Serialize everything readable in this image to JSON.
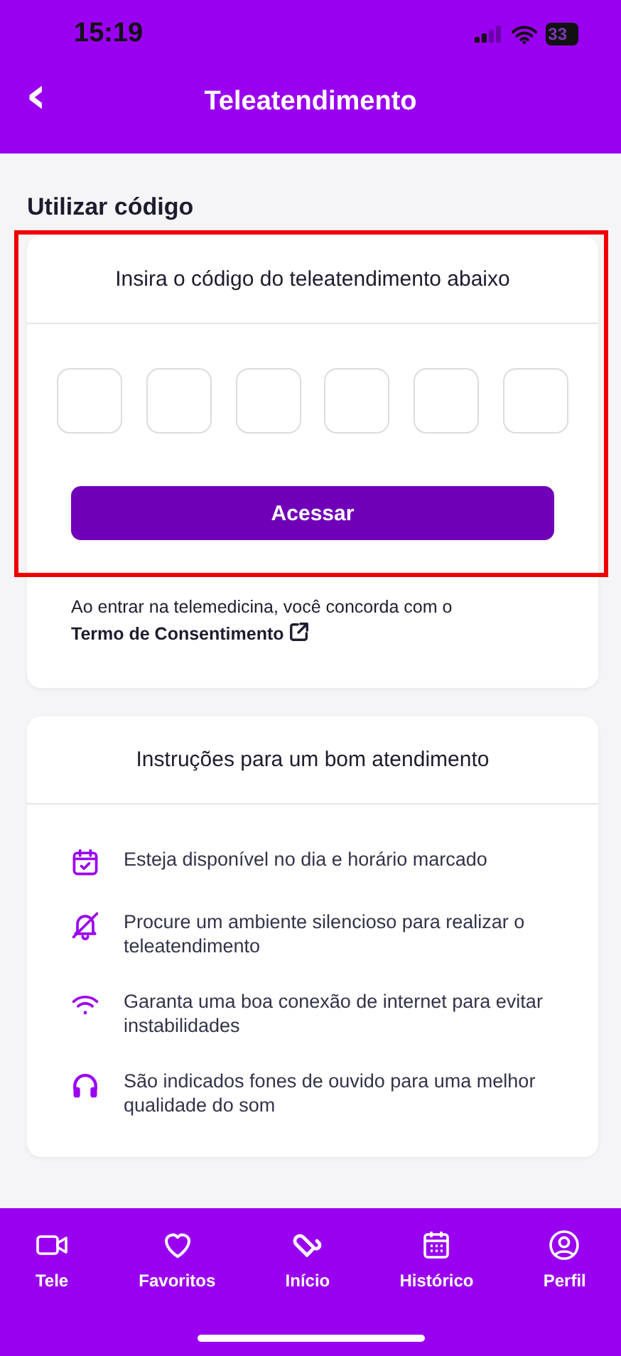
{
  "status_bar": {
    "time": "15:19",
    "battery": "33"
  },
  "header": {
    "back": "‹",
    "title": "Teleatendimento"
  },
  "section_title": "Utilizar código",
  "code_card": {
    "highlighted": true,
    "prompt": "Insira o código do teleatendimento abaixo",
    "digits": [
      {
        "kind": "digit"
      },
      {
        "kind": "digit"
      },
      {
        "kind": "digit"
      },
      {
        "kind": "digit"
      },
      {
        "kind": "digit"
      },
      {
        "kind": "digit"
      }
    ],
    "button": "Acessar",
    "consent_text": "Ao entrar na telemedicina, você concorda com o ",
    "consent_link": "Termo de Consentimento"
  },
  "instructions": {
    "title": "Instruções para um bom atendimento",
    "items": [
      {
        "kind": "calendar",
        "text": "Esteja disponível no dia e horário marcado"
      },
      {
        "kind": "silent",
        "text": "Procure um ambiente silencioso para realizar o teleatendimento"
      },
      {
        "kind": "wifi",
        "text": "Garanta uma boa conexão de internet para evitar instabilidades"
      },
      {
        "kind": "headphones",
        "text": "São indicados fones de ouvido para uma melhor qualidade do som"
      }
    ]
  },
  "nav": [
    {
      "kind": "video",
      "label": "Tele"
    },
    {
      "kind": "heart",
      "label": "Favoritos"
    },
    {
      "kind": "home",
      "label": "Início"
    },
    {
      "kind": "calendar",
      "label": "Histórico"
    },
    {
      "kind": "profile",
      "label": "Perfil"
    }
  ]
}
